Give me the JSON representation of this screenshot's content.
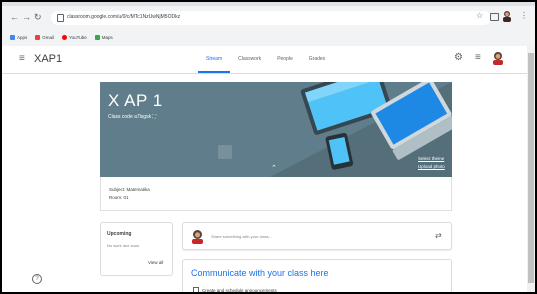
{
  "browser": {
    "url": "classroom.google.com/u/0/c/MTc1NzUwNjM5ODkz",
    "bookmarks": [
      {
        "label": "Apps",
        "color": "#4285f4"
      },
      {
        "label": "Gmail",
        "color": "#ea4335"
      },
      {
        "label": "YouTube",
        "color": "#ff0000"
      },
      {
        "label": "Maps",
        "color": "#34a853"
      }
    ]
  },
  "header": {
    "class_name": "XAP1",
    "tabs": [
      "Stream",
      "Classwork",
      "People",
      "Grades"
    ],
    "active_tab": "Stream"
  },
  "banner": {
    "title": "X AP 1",
    "class_code": "Class code  a7lsgsk ⛶",
    "select_theme": "Select theme",
    "upload_photo": "Upload photo",
    "color": "#607d8b"
  },
  "details": {
    "subject": "Subject: Matematika",
    "room": "Room: 01"
  },
  "upcoming": {
    "title": "Upcoming",
    "empty": "No work due soon",
    "view_all": "View all"
  },
  "share": {
    "placeholder": "Share something with your class..."
  },
  "communicate": {
    "title": "Communicate with your class here",
    "line": "Create and schedule announcements"
  },
  "colors": {
    "accent": "#1a73e8",
    "banner": "#607d8b"
  }
}
